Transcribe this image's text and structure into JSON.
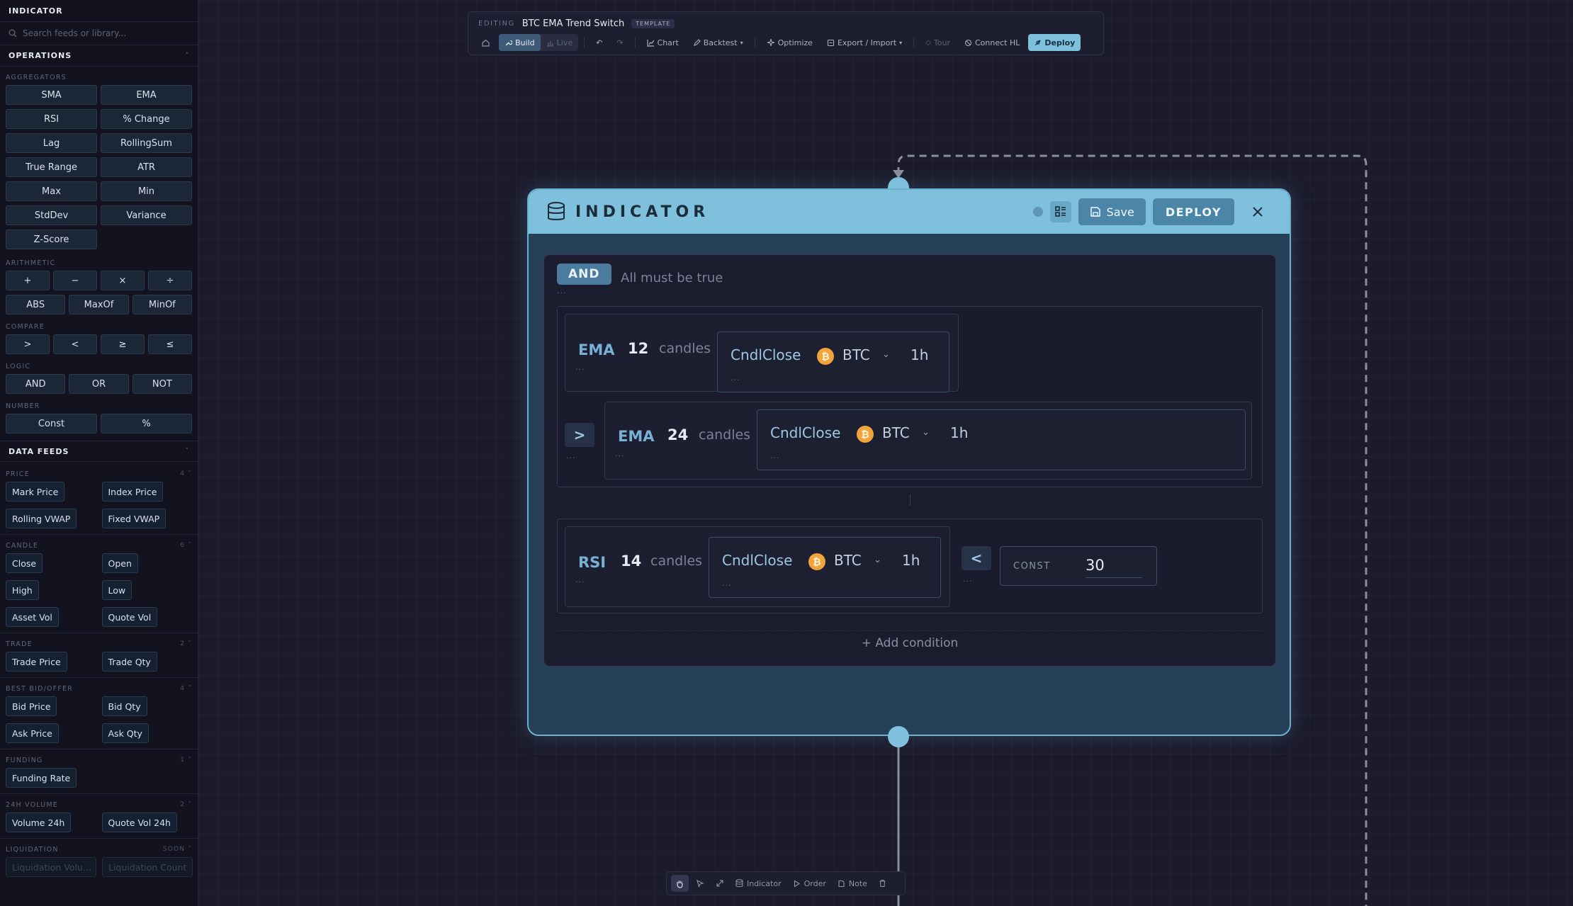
{
  "sidebar": {
    "title": "INDICATOR",
    "search_placeholder": "Search feeds or library...",
    "operations": {
      "label": "OPERATIONS",
      "groups": {
        "aggregators": {
          "label": "AGGREGATORS",
          "items": [
            "SMA",
            "EMA",
            "RSI",
            "% Change",
            "Lag",
            "RollingSum",
            "True Range",
            "ATR",
            "Max",
            "Min",
            "StdDev",
            "Variance",
            "Z-Score"
          ]
        },
        "arithmetic": {
          "label": "ARITHMETIC",
          "row1": [
            "+",
            "−",
            "×",
            "÷"
          ],
          "row2": [
            "ABS",
            "MaxOf",
            "MinOf"
          ]
        },
        "compare": {
          "label": "COMPARE",
          "items": [
            ">",
            "<",
            "≥",
            "≤"
          ]
        },
        "logic": {
          "label": "LOGIC",
          "items": [
            "AND",
            "OR",
            "NOT"
          ]
        },
        "number": {
          "label": "NUMBER",
          "items": [
            "Const",
            "%"
          ]
        }
      }
    },
    "data_feeds": {
      "label": "DATA FEEDS",
      "groups": {
        "price": {
          "label": "PRICE",
          "count": "4",
          "items": [
            "Mark Price",
            "Index Price",
            "Rolling VWAP",
            "Fixed VWAP"
          ]
        },
        "candle": {
          "label": "CANDLE",
          "count": "6",
          "items": [
            "Close",
            "Open",
            "High",
            "Low",
            "Asset Vol",
            "Quote Vol"
          ]
        },
        "trade": {
          "label": "TRADE",
          "count": "2",
          "items": [
            "Trade Price",
            "Trade Qty"
          ]
        },
        "bbo": {
          "label": "BEST BID/OFFER",
          "count": "4",
          "items": [
            "Bid Price",
            "Bid Qty",
            "Ask Price",
            "Ask Qty"
          ]
        },
        "funding": {
          "label": "FUNDING",
          "count": "1",
          "items": [
            "Funding Rate"
          ]
        },
        "volume": {
          "label": "24H VOLUME",
          "count": "2",
          "items": [
            "Volume 24h",
            "Quote Vol 24h"
          ]
        },
        "liquidation": {
          "label": "LIQUIDATION",
          "count": "SOON",
          "items": [
            "Liquidation Volu...",
            "Liquidation Count"
          ]
        }
      }
    }
  },
  "toolbar": {
    "editing_label": "EDITING",
    "strategy_name": "BTC EMA Trend Switch",
    "tag": "TEMPLATE",
    "build": "Build",
    "live": "Live",
    "chart": "Chart",
    "backtest": "Backtest",
    "optimize": "Optimize",
    "export_import": "Export / Import",
    "tour": "Tour",
    "connect": "Connect HL",
    "deploy": "Deploy"
  },
  "node": {
    "title": "INDICATOR",
    "save": "Save",
    "deploy": "DEPLOY",
    "logic": {
      "op": "AND",
      "desc": "All must be true",
      "dots": "..."
    },
    "cond1": {
      "left": {
        "fn": "EMA",
        "period": "12",
        "unit": "candles",
        "dots": "...",
        "source": {
          "field": "CndlClose",
          "asset": "BTC",
          "tf": "1h",
          "dots": "..."
        }
      },
      "op": ">",
      "op_dots": "...",
      "right": {
        "fn": "EMA",
        "period": "24",
        "unit": "candles",
        "dots": "...",
        "source": {
          "field": "CndlClose",
          "asset": "BTC",
          "tf": "1h",
          "dots": "..."
        }
      }
    },
    "cond2": {
      "left": {
        "fn": "RSI",
        "period": "14",
        "unit": "candles",
        "dots": "...",
        "source": {
          "field": "CndlClose",
          "asset": "BTC",
          "tf": "1h",
          "dots": "..."
        }
      },
      "op": "<",
      "op_dots": "...",
      "const_label": "CONST",
      "const_value": "30"
    },
    "add_condition": "+ Add condition"
  },
  "bottom_toolbar": {
    "indicator": "Indicator",
    "order": "Order",
    "note": "Note"
  },
  "colors": {
    "accent": "#7fc0dc",
    "node_bg": "#264057",
    "bitcoin": "#f0a43a"
  }
}
